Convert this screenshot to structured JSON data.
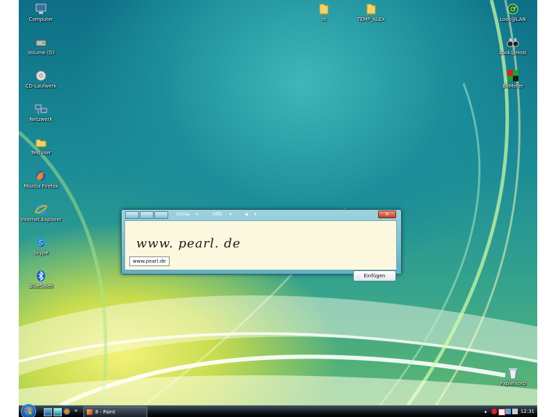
{
  "desktop": {
    "icons_left": [
      {
        "label": "Computer",
        "icon": "computer-icon"
      },
      {
        "label": "Volume (D)",
        "icon": "drive-icon"
      },
      {
        "label": "CD-Laufwerk",
        "icon": "cd-drive-icon"
      },
      {
        "label": "Netzwerk",
        "icon": "network-icon"
      },
      {
        "label": "Testuser",
        "icon": "user-folder-icon"
      },
      {
        "label": "Mozilla Firefox",
        "icon": "firefox-icon"
      },
      {
        "label": "Internet Explorer",
        "icon": "internet-explorer-icon"
      },
      {
        "label": "Skype",
        "icon": "skype-icon"
      },
      {
        "label": "BlueSoleil",
        "icon": "bluetooth-icon"
      }
    ],
    "icons_top": [
      {
        "label": "nt",
        "icon": "folder-icon"
      },
      {
        "label": "TEMP_ALEX",
        "icon": "folder-icon"
      }
    ],
    "icons_right": [
      {
        "label": "Look@LAN",
        "icon": "radar-icon"
      },
      {
        "label": "Look@Host",
        "icon": "binoculars-icon"
      },
      {
        "label": "BitMeter",
        "icon": "meter-icon"
      }
    ],
    "recycle_bin": {
      "label": "Papierkorb",
      "icon": "recycle-bin-icon"
    }
  },
  "tip": {
    "menu_extras": "Extras",
    "menu_help": "Hilfe",
    "handwriting": "www. pearl. de",
    "recognized": "www.pearl.de",
    "insert_label": "Einfügen",
    "close_glyph": "x"
  },
  "taskbar": {
    "overflow": "»",
    "active_task": "8 - Paint",
    "clock": "12:31"
  },
  "colors": {
    "taskbar": "#0d141a",
    "pad": "#fbf8df",
    "close": "#c43f26"
  }
}
